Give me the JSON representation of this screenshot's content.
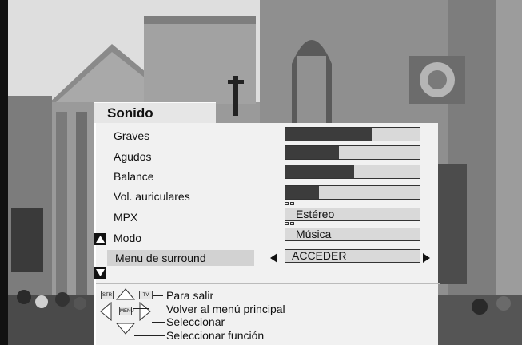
{
  "menu": {
    "title": "Sonido",
    "items": [
      {
        "label": "Graves",
        "type": "bar",
        "level": 0.64
      },
      {
        "label": "Agudos",
        "type": "bar",
        "level": 0.4
      },
      {
        "label": "Balance",
        "type": "bar",
        "level": 0.51
      },
      {
        "label": "Vol. auriculares",
        "type": "bar",
        "level": 0.25
      },
      {
        "label": "MPX",
        "type": "option",
        "value": "Estéreo"
      },
      {
        "label": "Modo",
        "type": "option",
        "value": "Música"
      },
      {
        "label": "Menu de surround",
        "type": "submenu",
        "value": "ACCEDER",
        "selected": true
      }
    ],
    "scroll_up_icon": "triangle-up-icon",
    "scroll_down_icon": "triangle-down-icon"
  },
  "help": {
    "exit": "Para salir",
    "main_menu": "Volver al menú principal",
    "select": "Seleccionar",
    "select_function": "Seleccionar función",
    "keys": {
      "str": "STR",
      "tv": "TV",
      "menu": "MENU"
    }
  },
  "colors": {
    "panel": "#f1f1f1",
    "bar_fill": "#3c3c3c",
    "bar_track": "#d9d9d9",
    "selected_row": "#d2d2d2"
  }
}
